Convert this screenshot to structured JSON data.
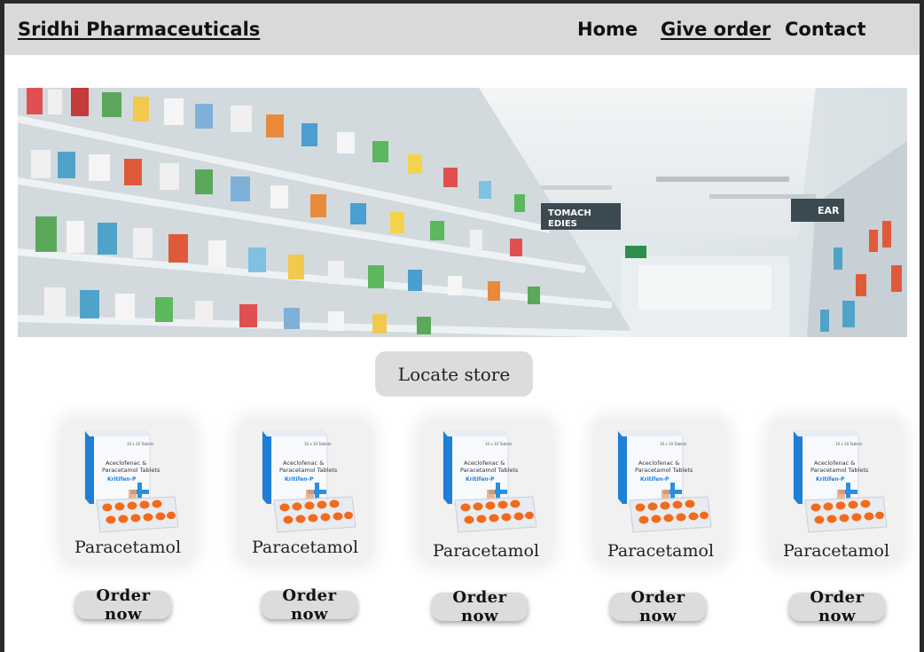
{
  "header": {
    "brand": "Sridhi Pharmaceuticals",
    "nav": [
      "Home",
      "Give order",
      "Contact"
    ],
    "active_nav": "Give order"
  },
  "hero": {
    "sign_left": "TOMACH\nEDIES",
    "sign_right": "EAR"
  },
  "locate_button": "Locate store",
  "products": [
    {
      "name": "Paracetamol",
      "order_label": "Order now",
      "box_line1": "Aceclofenac &",
      "box_line2": "Paracetamol Tablets",
      "box_brand": "Kritifen-P",
      "box_count": "10 x 10 Tablets"
    },
    {
      "name": "Paracetamol",
      "order_label": "Order now",
      "box_line1": "Aceclofenac &",
      "box_line2": "Paracetamol Tablets",
      "box_brand": "Kritifen-P",
      "box_count": "10 x 10 Tablets"
    },
    {
      "name": "Paracetamol",
      "order_label": "Order now",
      "box_line1": "Aceclofenac &",
      "box_line2": "Paracetamol Tablets",
      "box_brand": "Kritifen-P",
      "box_count": "10 x 10 Tablets"
    },
    {
      "name": "Paracetamol",
      "order_label": "Order now",
      "box_line1": "Aceclofenac &",
      "box_line2": "Paracetamol Tablets",
      "box_brand": "Kritifen-P",
      "box_count": "10 x 10 Tablets"
    },
    {
      "name": "Paracetamol",
      "order_label": "Order now",
      "box_line1": "Aceclofenac &",
      "box_line2": "Paracetamol Tablets",
      "box_brand": "Kritifen-P",
      "box_count": "10 x 10 Tablets"
    }
  ],
  "colors": {
    "header_bg": "#d9d9d9",
    "button_bg": "#dcdcdc",
    "card_bg": "#f1f1f1",
    "pill_orange": "#f26a1b",
    "box_blue": "#1f7fd6"
  }
}
